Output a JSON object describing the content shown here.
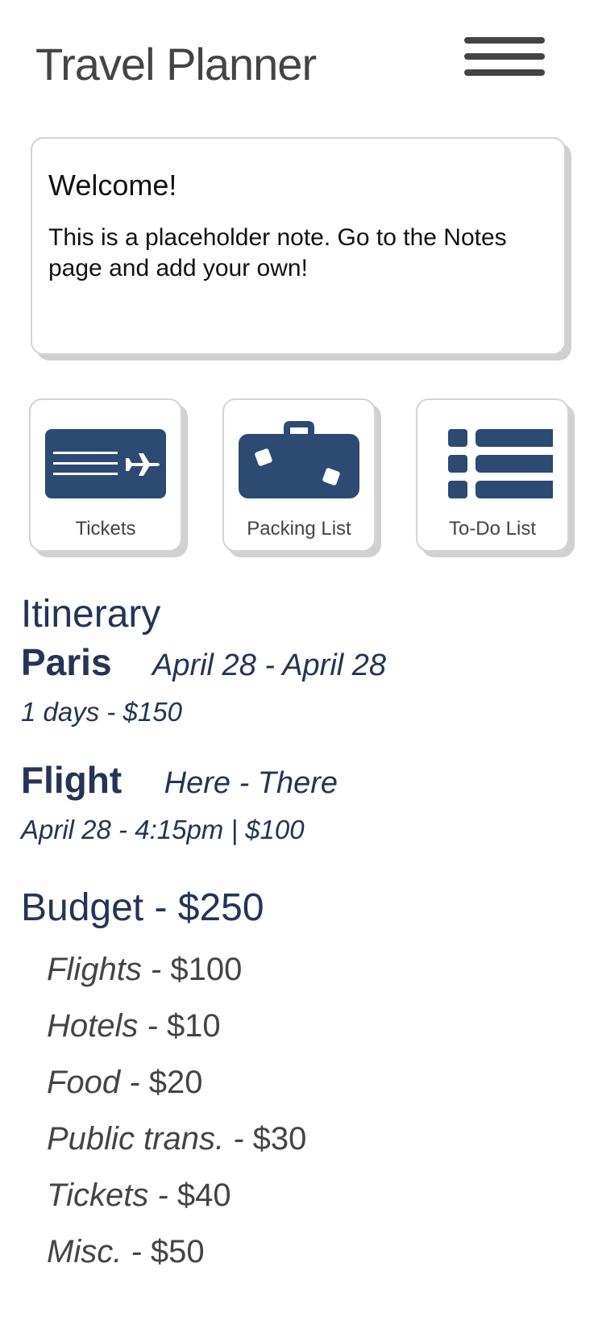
{
  "header": {
    "title": "Travel Planner",
    "menu_icon": "hamburger-menu-icon"
  },
  "note": {
    "title": "Welcome!",
    "body": "This is a placeholder note. Go to the Notes page and add your own!"
  },
  "shortcuts": [
    {
      "label": "Tickets",
      "icon": "ticket-plane-icon"
    },
    {
      "label": "Packing List",
      "icon": "suitcase-icon"
    },
    {
      "label": "To-Do List",
      "icon": "list-icon"
    }
  ],
  "itinerary": {
    "heading": "Itinerary",
    "trip": {
      "name": "Paris",
      "dates": "April 28 - April 28",
      "meta": "1 days - $150"
    },
    "flight": {
      "type": "Flight",
      "route": "Here - There",
      "meta": "April 28 - 4:15pm | $100"
    }
  },
  "budget": {
    "heading": "Budget - $250",
    "items": [
      {
        "name": "Flights",
        "amount": "$100"
      },
      {
        "name": "Hotels",
        "amount": "$10"
      },
      {
        "name": "Food",
        "amount": "$20"
      },
      {
        "name": "Public trans.",
        "amount": "$30"
      },
      {
        "name": "Tickets",
        "amount": "$40"
      },
      {
        "name": "Misc.",
        "amount": "$50"
      }
    ]
  },
  "colors": {
    "accent": "#2c4a72",
    "heading_text": "#233457",
    "body_text": "#444444",
    "card_border": "#d4d4d4",
    "card_shadow": "#d0d0d0"
  }
}
